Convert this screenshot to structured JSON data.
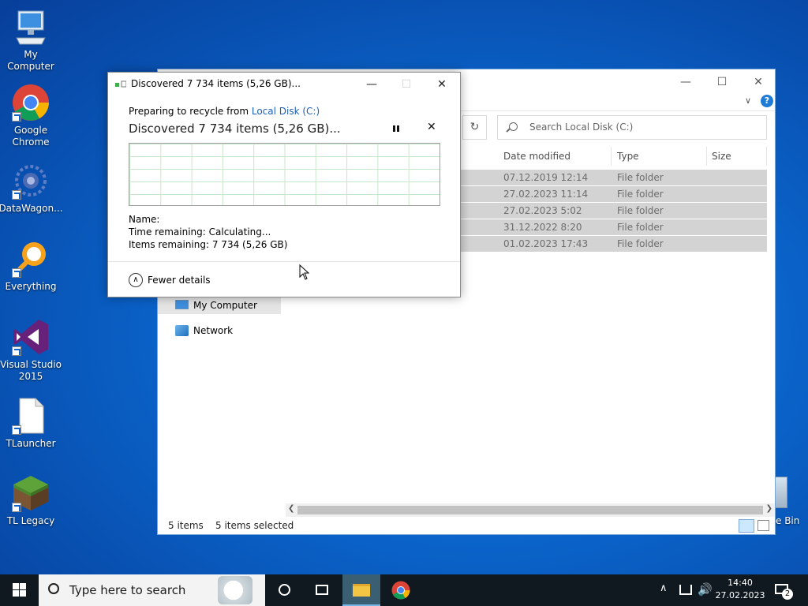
{
  "desktop": {
    "icons": [
      {
        "label": "My Computer",
        "icon": "computer-icon"
      },
      {
        "label": "Google\nChrome",
        "icon": "chrome-icon"
      },
      {
        "label": "DataWagon...",
        "icon": "datawagon-icon"
      },
      {
        "label": "Everything",
        "icon": "everything-icon"
      },
      {
        "label": "Visual Studio\n2015",
        "icon": "visual-studio-icon"
      },
      {
        "label": "TLauncher",
        "icon": "file-icon"
      },
      {
        "label": "TL Legacy",
        "icon": "minecraft-icon"
      }
    ],
    "recycle_bin_label": "e Bin"
  },
  "explorer": {
    "search_placeholder": "Search Local Disk (C:)",
    "columns": [
      "Date modified",
      "Type",
      "Size"
    ],
    "rows": [
      {
        "date": "07.12.2019 12:14",
        "type": "File folder"
      },
      {
        "date": "27.02.2023 11:14",
        "type": "File folder"
      },
      {
        "date": "27.02.2023 5:02",
        "type": "File folder"
      },
      {
        "date": "31.12.2022 8:20",
        "type": "File folder"
      },
      {
        "date": "01.02.2023 17:43",
        "type": "File folder"
      }
    ],
    "nav": {
      "my_computer": "My Computer",
      "network": "Network"
    },
    "status": {
      "items": "5 items",
      "selected": "5 items selected"
    }
  },
  "dialog": {
    "title": "Discovered 7 734 items (5,26 GB)...",
    "preparing_prefix": "Preparing to recycle from",
    "source_link": "Local Disk (C:)",
    "heading": "Discovered 7 734 items (5,26 GB)...",
    "name_label": "Name:",
    "time_label": "Time remaining:",
    "time_value": "Calculating...",
    "items_label": "Items remaining:",
    "items_value": "7 734 (5,26 GB)",
    "fewer_details": "Fewer details"
  },
  "taskbar": {
    "search_placeholder": "Type here to search",
    "time": "14:40",
    "date": "27.02.2023",
    "notification_count": "2"
  }
}
